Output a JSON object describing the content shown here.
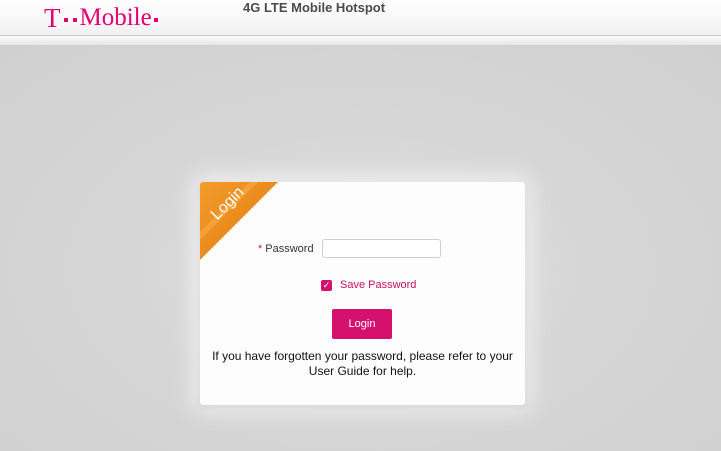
{
  "header": {
    "brand_t": "T",
    "brand_word": "Mobile",
    "title": "4G LTE Mobile Hotspot",
    "brand_color": "#e20074"
  },
  "login_card": {
    "ribbon_label": "Login",
    "ribbon_color": "#ee8a1a",
    "password": {
      "required_marker": "*",
      "label": "Password",
      "value": "",
      "placeholder": ""
    },
    "save_password": {
      "checked": true,
      "label": "Save Password"
    },
    "login_button_label": "Login",
    "help_text": "If you have forgotten your password, please refer to your User Guide for help."
  }
}
